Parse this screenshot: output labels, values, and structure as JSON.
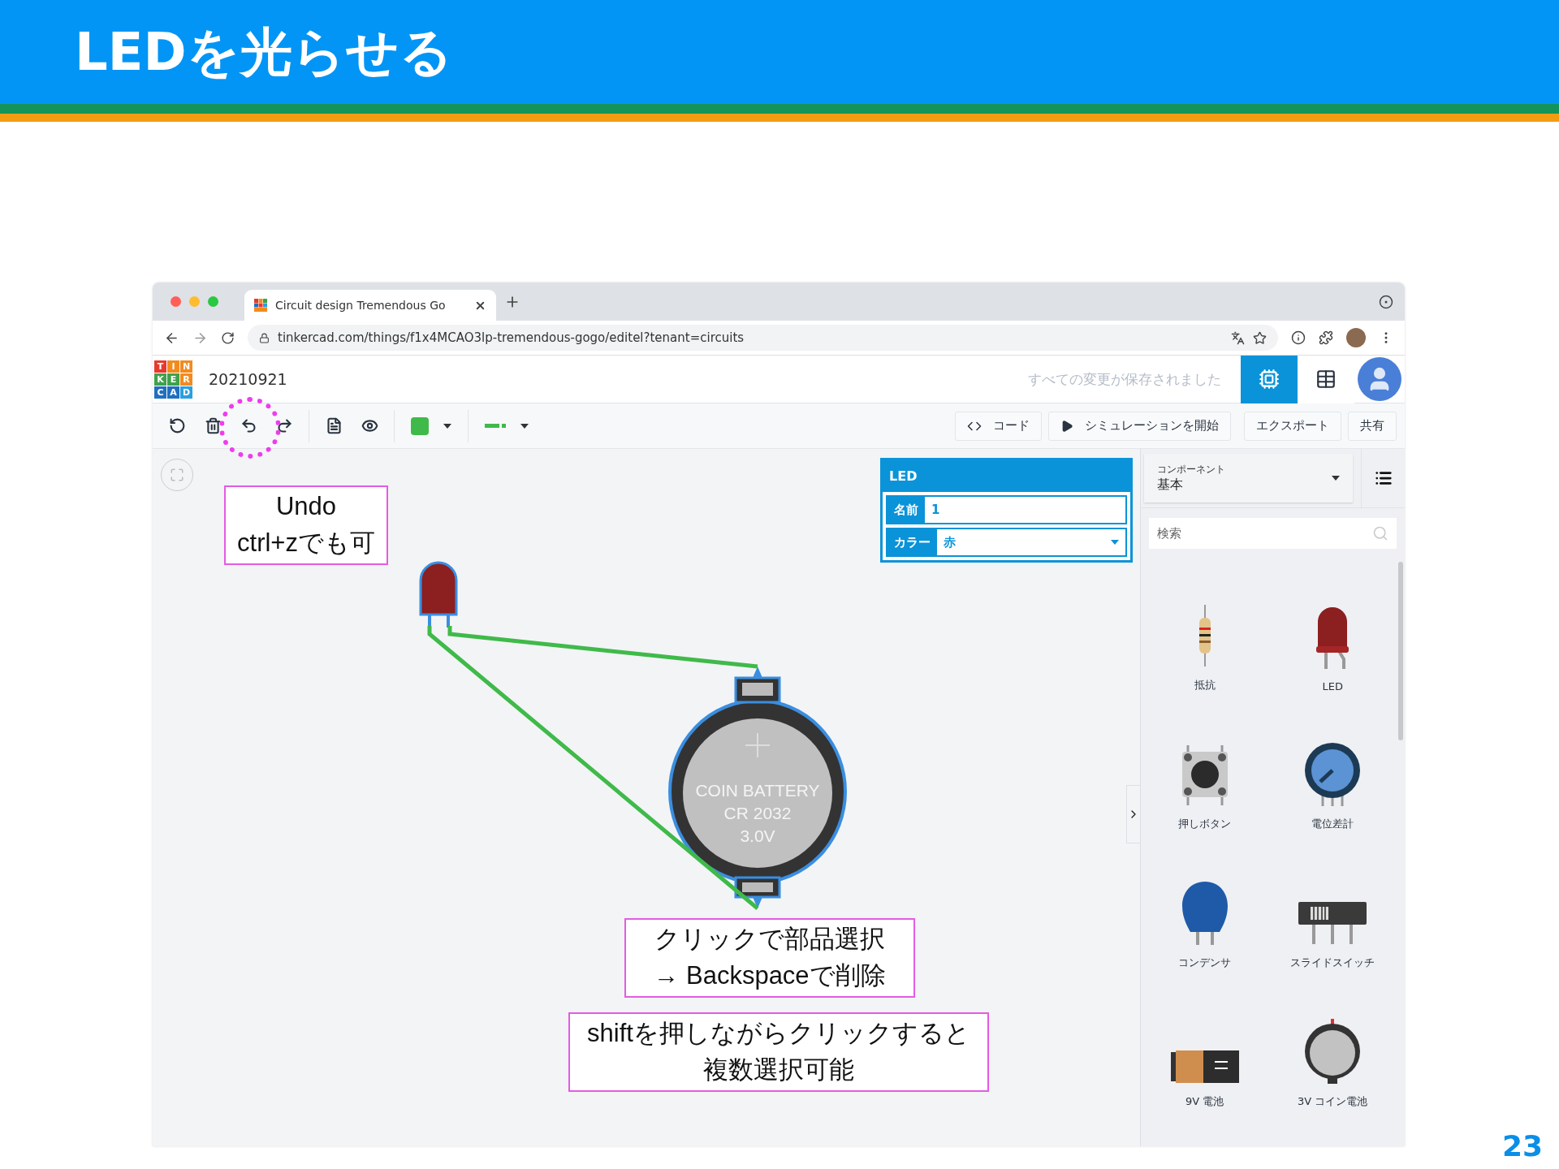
{
  "slide": {
    "title": "LEDを光らせる",
    "page_number": "23"
  },
  "browser": {
    "tab": {
      "title": "Circuit design Tremendous Go"
    },
    "url": "tinkercad.com/things/f1x4MCAO3lp-tremendous-gogo/editel?tenant=circuits"
  },
  "app": {
    "logo": [
      "T",
      "I",
      "N",
      "K",
      "E",
      "R",
      "C",
      "A",
      "D"
    ],
    "design_name": "20210921",
    "save_status": "すべての変更が保存されました",
    "views": [
      {
        "kind": "circuit",
        "selected": true
      },
      {
        "kind": "list",
        "selected": false
      }
    ]
  },
  "toolbar": {
    "tools": [
      {
        "kind": "rotate",
        "highlighted": false
      },
      {
        "kind": "delete",
        "highlighted": false
      },
      {
        "kind": "undo",
        "highlighted": true
      },
      {
        "kind": "redo",
        "highlighted": false
      },
      {
        "kind": "notes",
        "highlighted": false
      },
      {
        "kind": "view",
        "highlighted": false
      }
    ],
    "actions": [
      {
        "kind": "code",
        "label": "コード"
      },
      {
        "kind": "simulate",
        "label": "シミュレーションを開始"
      },
      {
        "kind": "plain",
        "label": "エクスポート"
      },
      {
        "kind": "plain",
        "label": "共有"
      }
    ]
  },
  "inspector": {
    "title": "LED",
    "fields": [
      {
        "kind": "text",
        "label": "名前",
        "value": "1"
      },
      {
        "kind": "select",
        "label": "カラー",
        "value": "赤"
      }
    ]
  },
  "canvas": {
    "battery_label": [
      "COIN BATTERY",
      "CR 2032",
      "3.0V"
    ]
  },
  "annotations": [
    {
      "lines": [
        "Undo",
        "ctrl+zでも可"
      ]
    },
    {
      "lines": [
        "クリックで部品選択",
        "→ Backspaceで削除"
      ]
    },
    {
      "lines": [
        "shiftを押しながらクリックすると",
        "複数選択可能"
      ]
    }
  ],
  "components": {
    "category_label": "コンポーネント",
    "category": "基本",
    "search": {
      "placeholder": "検索"
    },
    "items": [
      {
        "kind": "resistor",
        "label": "抵抗"
      },
      {
        "kind": "led",
        "label": "LED"
      },
      {
        "kind": "pushbutton",
        "label": "押しボタン"
      },
      {
        "kind": "potentiometer",
        "label": "電位差計"
      },
      {
        "kind": "capacitor",
        "label": "コンデンサ"
      },
      {
        "kind": "slideswitch",
        "label": "スライドスイッチ"
      },
      {
        "kind": "battery9v",
        "label": "9V 電池"
      },
      {
        "kind": "coincell",
        "label": "3V コイン電池"
      }
    ]
  }
}
